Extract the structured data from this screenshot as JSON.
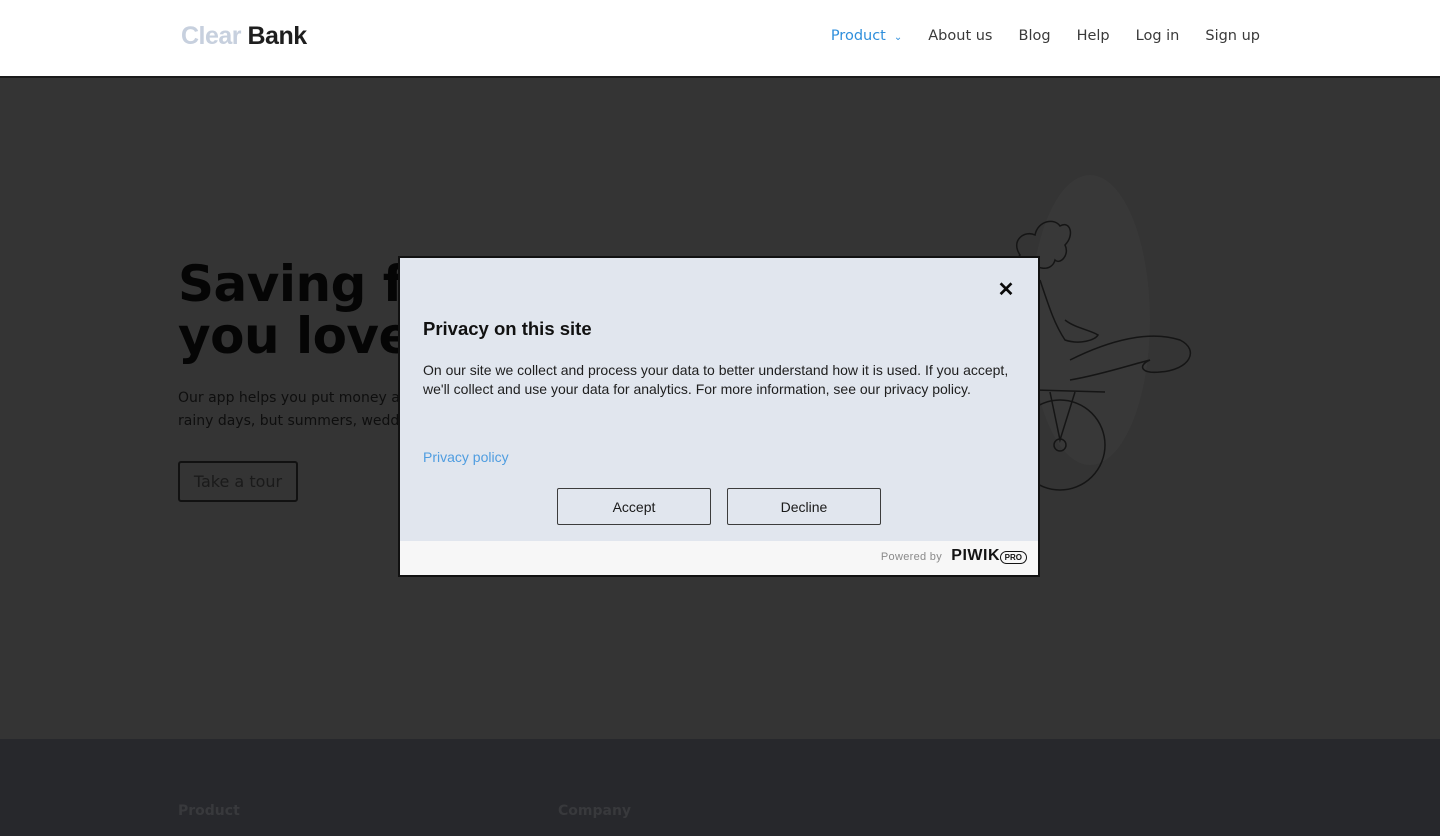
{
  "header": {
    "logo": {
      "part1": "Clear",
      "part2": "Bank"
    },
    "nav": [
      {
        "label": "Product",
        "active": true,
        "has_dropdown": true
      },
      {
        "label": "About us"
      },
      {
        "label": "Blog"
      },
      {
        "label": "Help"
      },
      {
        "label": "Log in"
      },
      {
        "label": "Sign up"
      }
    ],
    "chevron_icon": "⌄"
  },
  "hero": {
    "title_line1": "Saving f",
    "title_line2": "you love",
    "text_line1": "Our app helps you put money asi",
    "text_line2": "rainy days, but summers, weddin",
    "tour_button": "Take a tour"
  },
  "footer": {
    "columns": [
      "Product",
      "Company"
    ]
  },
  "privacy_modal": {
    "close_icon": "✕",
    "title": "Privacy on this site",
    "body": "On our site we collect and process your data to better understand how it is used. If you accept, we'll collect and use your data for analytics. For more information, see our privacy policy.",
    "privacy_link": "Privacy policy",
    "accept_label": "Accept",
    "decline_label": "Decline",
    "powered_by": "Powered by",
    "brand": "PIWIK",
    "brand_badge": "PRO"
  },
  "colors": {
    "accent": "#2f8fdc",
    "link": "#4f9de0",
    "modal_bg": "#e1e6ee",
    "overlay": "#343434",
    "footer_bg": "#27282c"
  }
}
